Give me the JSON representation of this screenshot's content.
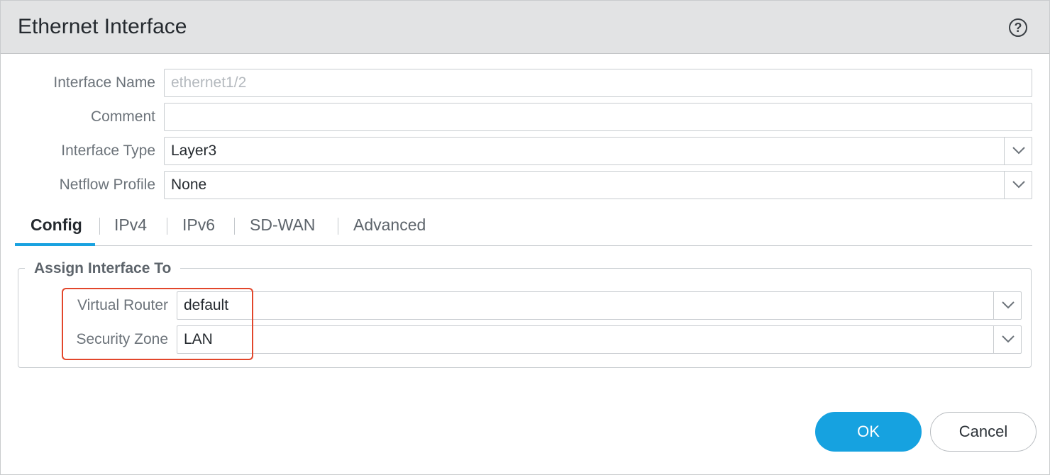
{
  "dialog": {
    "title": "Ethernet Interface",
    "help_icon": "question-circle-icon"
  },
  "form": {
    "interface_name": {
      "label": "Interface Name",
      "value": "ethernet1/2"
    },
    "comment": {
      "label": "Comment",
      "value": ""
    },
    "interface_type": {
      "label": "Interface Type",
      "value": "Layer3"
    },
    "netflow_profile": {
      "label": "Netflow Profile",
      "value": "None"
    }
  },
  "tabs": [
    {
      "label": "Config",
      "active": true
    },
    {
      "label": "IPv4",
      "active": false
    },
    {
      "label": "IPv6",
      "active": false
    },
    {
      "label": "SD-WAN",
      "active": false
    },
    {
      "label": "Advanced",
      "active": false
    }
  ],
  "assign": {
    "legend": "Assign Interface To",
    "virtual_router": {
      "label": "Virtual Router",
      "value": "default"
    },
    "security_zone": {
      "label": "Security Zone",
      "value": "LAN"
    }
  },
  "footer": {
    "ok_label": "OK",
    "cancel_label": "Cancel"
  },
  "colors": {
    "accent": "#16a2e0",
    "highlight": "#e2462b",
    "titlebar": "#e2e3e4"
  }
}
